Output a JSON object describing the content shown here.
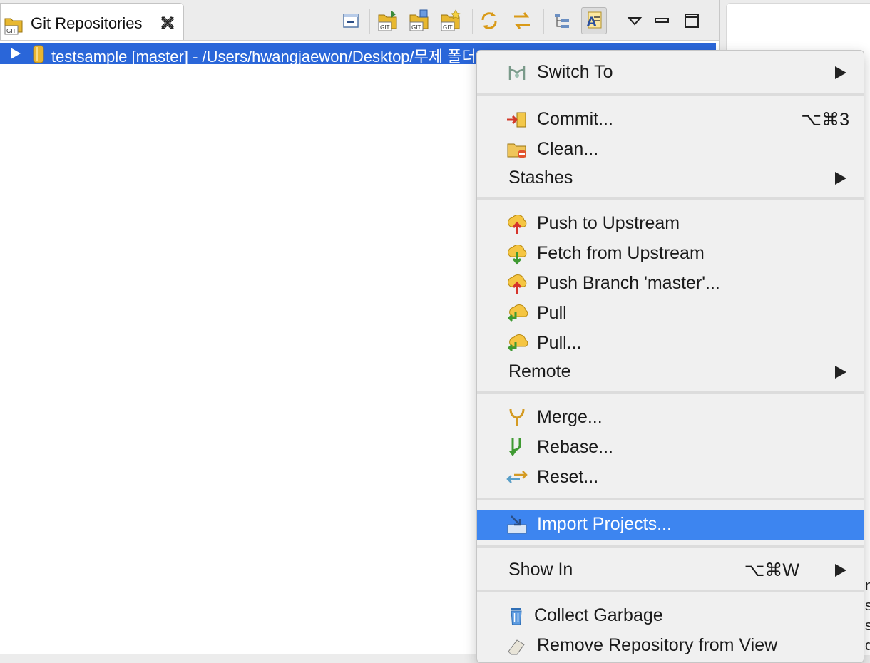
{
  "view": {
    "title": "Git Repositories",
    "repository_row": "testsample [master] - /Users/hwangjaewon/Desktop/무제 폴더/testsample/.git"
  },
  "toolbar": {
    "buttons": [
      "collapse-all-icon",
      "clone-repository-icon",
      "add-repository-icon",
      "create-repository-icon",
      "link-with-selection-icon",
      "sync-icon",
      "hierarchical-layout-icon",
      "filter-icon",
      "view-menu-icon",
      "minimize-icon",
      "maximize-icon"
    ]
  },
  "context_menu": {
    "switch_to": "Switch To",
    "commit": "Commit...",
    "commit_shortcut": "⌥⌘3",
    "clean": "Clean...",
    "stashes": "Stashes",
    "push_upstream": "Push to Upstream",
    "fetch_upstream": "Fetch from Upstream",
    "push_branch": "Push Branch 'master'...",
    "pull": "Pull",
    "pull_dialog": "Pull...",
    "remote": "Remote",
    "merge": "Merge...",
    "rebase": "Rebase...",
    "reset": "Reset...",
    "import_projects": "Import Projects...",
    "show_in": "Show In",
    "show_in_shortcut": "⌥⌘W",
    "collect_garbage": "Collect Garbage",
    "remove_repository": "Remove Repository from View"
  },
  "background_panel": {
    "fragments": [
      "nt",
      "st",
      "st",
      "d"
    ]
  },
  "colors": {
    "selection": "#2a66d9",
    "menu_highlight": "#3d85f0",
    "menu_background": "#f0f0f0"
  }
}
